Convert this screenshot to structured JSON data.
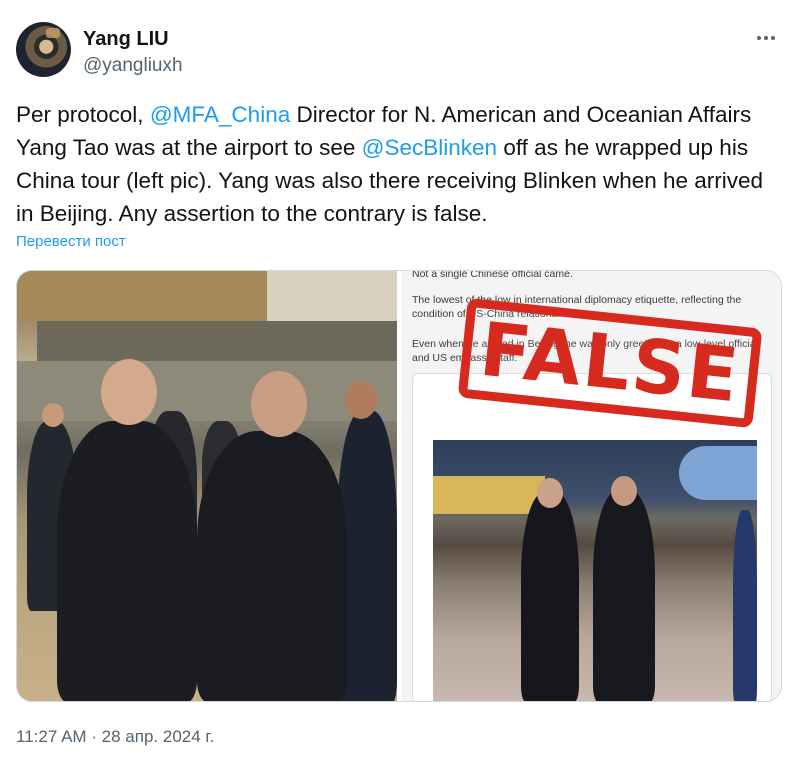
{
  "author": {
    "name": "Yang LIU",
    "handle": "@yangliuxh"
  },
  "tweet": {
    "text_part1": "Per protocol, ",
    "mention1": "@MFA_China",
    "text_part2": " Director for N. American and Oceanian Affairs Yang Tao was at the airport to see ",
    "mention2": "@SecBlinken",
    "text_part3": " off as he wrapped up his China tour (left pic). Yang was also there receiving Blinken when he arrived in Beijing. Any assertion to the contrary is false.",
    "translate_label": "Перевести пост",
    "timestamp": "11:27 AM · 28 апр. 2024 г."
  },
  "media": {
    "embedded_text_line1": "Not a single Chinese official came.",
    "embedded_text_line2": "The lowest of the low in international diplomacy etiquette, reflecting the",
    "embedded_text_line3": "condition of US-China relations.",
    "embedded_text_line4": "Even when he arrived in Beijing, he was only greeted by a low-level official",
    "embedded_text_line5": "and US embassy staff.",
    "stamp_text": "FALSE",
    "stamp_color": "#d72a1f"
  },
  "colors": {
    "link": "#1d9bf0",
    "secondary_text": "#536471",
    "primary_text": "#0f1419"
  },
  "icons": {
    "more": "more-horizontal-icon"
  }
}
